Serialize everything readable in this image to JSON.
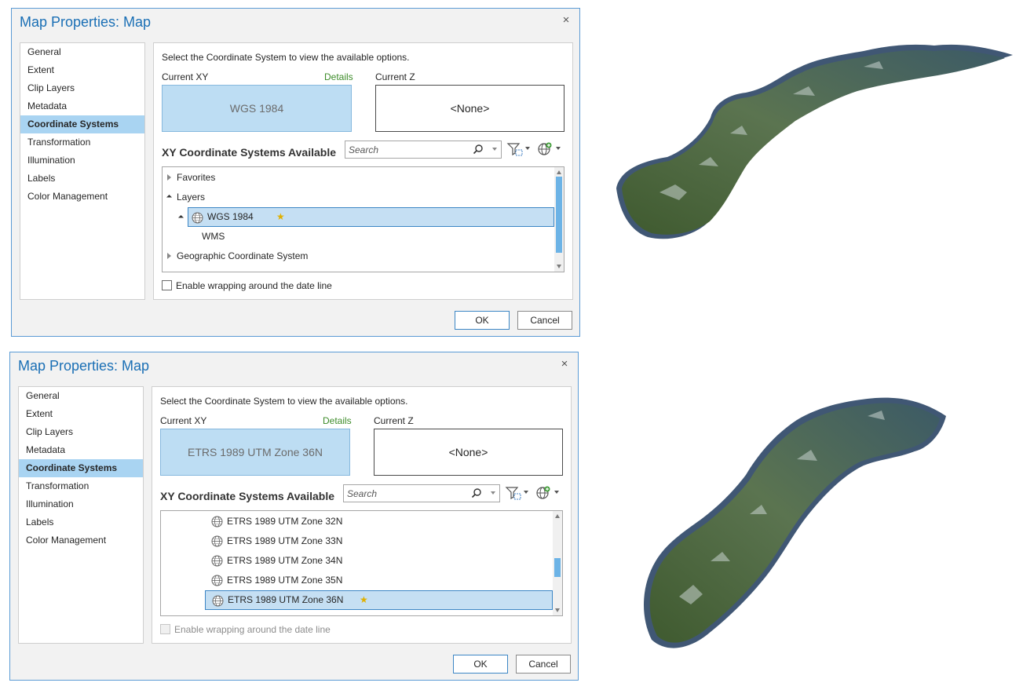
{
  "dialogs": [
    {
      "title": "Map Properties: Map",
      "close_glyph": "×",
      "nav": [
        "General",
        "Extent",
        "Clip Layers",
        "Metadata",
        "Coordinate Systems",
        "Transformation",
        "Illumination",
        "Labels",
        "Color Management"
      ],
      "nav_selected": "Coordinate Systems",
      "instruction": "Select the Coordinate System to view the available options.",
      "current_xy_label": "Current XY",
      "details_label": "Details",
      "current_z_label": "Current Z",
      "current_xy_value": "WGS 1984",
      "current_z_value": "<None>",
      "available_label": "XY Coordinate Systems Available",
      "search_placeholder": "Search",
      "tree": [
        {
          "label": "Favorites",
          "twisty": "collapsed",
          "level": 0
        },
        {
          "label": "Layers",
          "twisty": "expanded",
          "level": 0
        },
        {
          "label": "WGS 1984",
          "twisty": "expanded",
          "level": 1,
          "globe": true,
          "selected": true,
          "favorite": true
        },
        {
          "label": "WMS",
          "twisty": "none",
          "level": 2
        },
        {
          "label": "Geographic Coordinate System",
          "twisty": "collapsed",
          "level": 0
        }
      ],
      "scroll_position": 0.0,
      "wrap_label": "Enable wrapping around the date line",
      "wrap_enabled": true,
      "wrap_checked": false,
      "ok_label": "OK",
      "cancel_label": "Cancel"
    },
    {
      "title": "Map Properties: Map",
      "close_glyph": "×",
      "nav": [
        "General",
        "Extent",
        "Clip Layers",
        "Metadata",
        "Coordinate Systems",
        "Transformation",
        "Illumination",
        "Labels",
        "Color Management"
      ],
      "nav_selected": "Coordinate Systems",
      "instruction": "Select the Coordinate System to view the available options.",
      "current_xy_label": "Current XY",
      "details_label": "Details",
      "current_z_label": "Current Z",
      "current_xy_value": "ETRS 1989 UTM Zone 36N",
      "current_z_value": "<None>",
      "available_label": "XY Coordinate Systems Available",
      "search_placeholder": "Search",
      "tree": [
        {
          "label": "ETRS 1989 UTM Zone 32N",
          "twisty": "none",
          "level": 3,
          "globe": true
        },
        {
          "label": "ETRS 1989 UTM Zone 33N",
          "twisty": "none",
          "level": 3,
          "globe": true
        },
        {
          "label": "ETRS 1989 UTM Zone 34N",
          "twisty": "none",
          "level": 3,
          "globe": true
        },
        {
          "label": "ETRS 1989 UTM Zone 35N",
          "twisty": "none",
          "level": 3,
          "globe": true
        },
        {
          "label": "ETRS 1989 UTM Zone 36N",
          "twisty": "none",
          "level": 3,
          "globe": true,
          "selected": true,
          "favorite": true
        }
      ],
      "scroll_position": 0.55,
      "wrap_label": "Enable wrapping around the date line",
      "wrap_enabled": false,
      "wrap_checked": false,
      "ok_label": "OK",
      "cancel_label": "Cancel"
    }
  ],
  "colors": {
    "accent": "#1a6fb5",
    "selected_nav": "#a9d4f2",
    "current_xy_fill": "#bdddf3",
    "tree_selected": "#c5dff3",
    "details_link": "#3d8c2a",
    "favorite_star": "#e0b000",
    "land_green": "#4e6a3c",
    "sea_blue": "#2c4f7c"
  },
  "map_images": [
    {
      "subject": "satellite-render-norway-geographic"
    },
    {
      "subject": "satellite-render-norway-utm36n"
    }
  ]
}
